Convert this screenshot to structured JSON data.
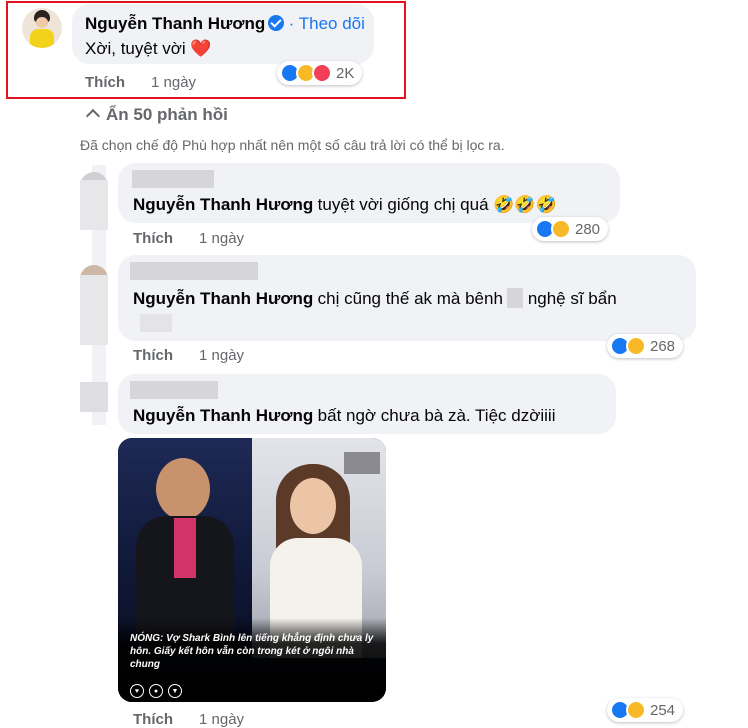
{
  "top_comment": {
    "author": "Nguyễn Thanh Hương",
    "follow": "· Theo dõi",
    "text": "Xời, tuyệt vời ❤️",
    "like": "Thích",
    "time": "1 ngày",
    "reactions": "2K"
  },
  "replies_toggle": "Ẩn 50 phản hồi",
  "filter_note": "Đã chọn chế độ Phù hợp nhất nên một số câu trả lời có thể bị lọc ra.",
  "replies": [
    {
      "author": "Nguyễn Thanh Hương",
      "text": "tuyệt vời giống chị quá 🤣🤣🤣",
      "like": "Thích",
      "time": "1 ngày",
      "reactions": "280"
    },
    {
      "author": "Nguyễn Thanh Hương",
      "text": "chị cũng thế ak mà bênh",
      "text2": "nghệ sĩ bẩn",
      "like": "Thích",
      "time": "1 ngày",
      "reactions": "268"
    },
    {
      "author": "Nguyễn Thanh Hương",
      "text": "bất ngờ chưa bà zà. Tiệc dzờiiii",
      "like": "Thích",
      "time": "1 ngày",
      "reactions": "254"
    }
  ],
  "image_caption": "NÓNG: Vợ Shark Bình lên tiếng khẳng định chưa ly hôn. Giấy kết hôn vẫn còn trong két ở ngôi nhà chung",
  "colors": {
    "accent": "#1877f2",
    "highlight": "#e0141e",
    "bubble": "#f0f2f5"
  }
}
